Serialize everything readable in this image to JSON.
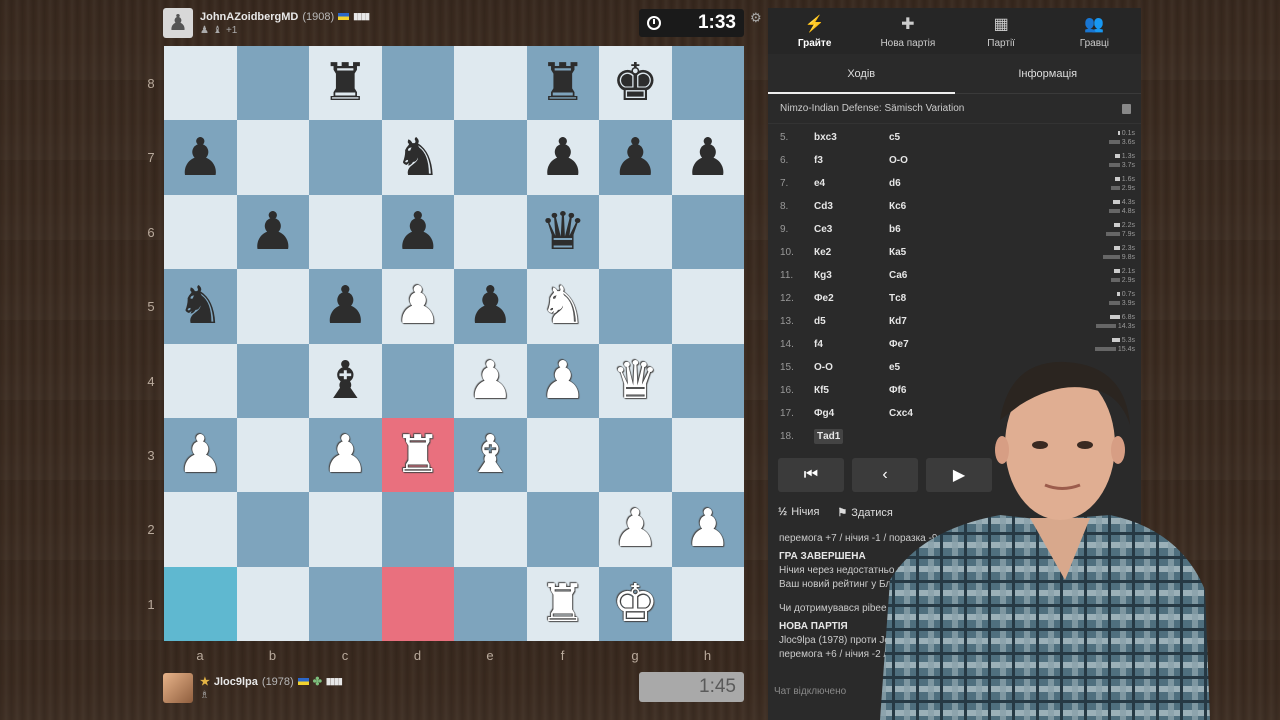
{
  "top_player": {
    "name": "JohnAZoidbergMD",
    "rating": "(1908)",
    "bars": "▮▮▮▮",
    "extra": "+1"
  },
  "top_clock": "1:33",
  "bottom_player": {
    "name": "Jloc9lpa",
    "rating": "(1978)",
    "bars": "▮▮▮▮"
  },
  "bottom_clock": "1:45",
  "ranks": [
    "8",
    "7",
    "6",
    "5",
    "4",
    "3",
    "2",
    "1"
  ],
  "files": [
    "a",
    "b",
    "c",
    "d",
    "e",
    "f",
    "g",
    "h"
  ],
  "board": [
    [
      "",
      "",
      "br",
      "",
      "",
      "br",
      "bk",
      ""
    ],
    [
      "bp",
      "",
      "",
      "bn",
      "",
      "bp",
      "bp",
      "bp"
    ],
    [
      "",
      "bp",
      "",
      "bp",
      "",
      "bq",
      "",
      ""
    ],
    [
      "bn",
      "",
      "bp",
      "wp",
      "bp",
      "wn",
      "",
      ""
    ],
    [
      "",
      "",
      "bb",
      "",
      "wp",
      "wp",
      "wq",
      ""
    ],
    [
      "wp",
      "",
      "wp",
      "wr",
      "wb",
      "",
      "",
      ""
    ],
    [
      "",
      "",
      "",
      "",
      "",
      "",
      "wp",
      "wp"
    ],
    [
      "",
      "",
      "",
      "",
      "",
      "wr",
      "wk",
      ""
    ]
  ],
  "highlights": {
    "red": [
      "d3",
      "d1"
    ],
    "cyan": [
      "a1"
    ]
  },
  "tabs": [
    {
      "icon": "⚡",
      "label": "Грайте"
    },
    {
      "icon": "✚",
      "label": "Нова партія"
    },
    {
      "icon": "▦",
      "label": "Партії"
    },
    {
      "icon": "👥",
      "label": "Гравці"
    }
  ],
  "subtabs": [
    "Ходів",
    "Інформація"
  ],
  "opening": "Nimzo-Indian Defense: Sämisch Variation",
  "moves": [
    {
      "n": "5.",
      "w": "bxc3",
      "b": "c5",
      "tw": "0.1s",
      "tb": "3.6s",
      "ww": 2,
      "wb": 11
    },
    {
      "n": "6.",
      "w": "f3",
      "b": "O-O",
      "tw": "1.3s",
      "tb": "3.7s",
      "ww": 5,
      "wb": 11
    },
    {
      "n": "7.",
      "w": "e4",
      "b": "d6",
      "tw": "1.6s",
      "tb": "2.9s",
      "ww": 5,
      "wb": 9
    },
    {
      "n": "8.",
      "w": "Cd3",
      "b": "Кc6",
      "tw": "4.3s",
      "tb": "4.8s",
      "ww": 7,
      "wb": 11
    },
    {
      "n": "9.",
      "w": "Ce3",
      "b": "b6",
      "tw": "2.2s",
      "tb": "7.9s",
      "ww": 6,
      "wb": 14
    },
    {
      "n": "10.",
      "w": "Кe2",
      "b": "Кa5",
      "tw": "2.3s",
      "tb": "9.8s",
      "ww": 6,
      "wb": 17
    },
    {
      "n": "11.",
      "w": "Кg3",
      "b": "Ca6",
      "tw": "2.1s",
      "tb": "2.9s",
      "ww": 6,
      "wb": 9
    },
    {
      "n": "12.",
      "w": "Фe2",
      "b": "Тc8",
      "tw": "0.7s",
      "tb": "3.9s",
      "ww": 3,
      "wb": 11
    },
    {
      "n": "13.",
      "w": "d5",
      "b": "Кd7",
      "tw": "6.8s",
      "tb": "14.3s",
      "ww": 10,
      "wb": 20
    },
    {
      "n": "14.",
      "w": "f4",
      "b": "Фe7",
      "tw": "5.3s",
      "tb": "15.4s",
      "ww": 8,
      "wb": 21
    },
    {
      "n": "15.",
      "w": "O-O",
      "b": "e5",
      "tw": "",
      "tb": "",
      "ww": 0,
      "wb": 0
    },
    {
      "n": "16.",
      "w": "Кf5",
      "b": "Фf6",
      "tw": "",
      "tb": "",
      "ww": 0,
      "wb": 0
    },
    {
      "n": "17.",
      "w": "Фg4",
      "b": "Cxc4",
      "tw": "",
      "tb": "",
      "ww": 0,
      "wb": 0
    },
    {
      "n": "18.",
      "w": "Тad1",
      "b": "",
      "tw": "",
      "tb": "",
      "ww": 0,
      "wb": 0
    }
  ],
  "actions": {
    "draw": "Нічия",
    "resign": "Здатися"
  },
  "info": {
    "stats1": "перемога +7 / нічия -1 / поразка -9",
    "ended": "ГРА ЗАВЕРШЕНА",
    "line1": "Нічия через недостатньо кіл",
    "line2": "Ваш новий рейтинг у Бліц с",
    "line3": "Чи дотримувався pibee п",
    "newgame": "НОВА ПАРТІЯ",
    "line4": "Jloc9lpa (1978) проти Jo",
    "stats2": "перемога +6 / нічия -2 /"
  },
  "chat": "Чат відключено"
}
